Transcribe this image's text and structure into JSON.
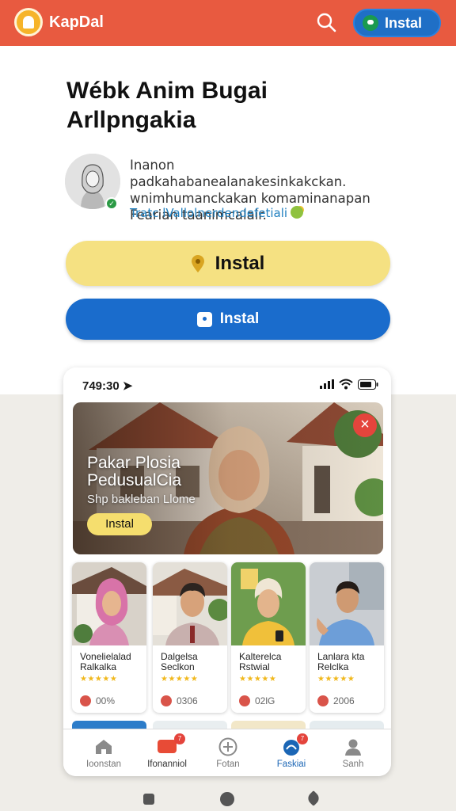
{
  "app": {
    "name": "KapDal",
    "install_label": "Instal"
  },
  "hero": {
    "headline": "Wébk Anim Bugai Arllpngakia",
    "description": "Inanon padkahabanealanakesinkakckan. wnimhumanckakan komaminanapan Fearian taanimcalair.",
    "link_text": "Tratc lVallolnerdendefetiali",
    "primary_button": "Instal",
    "secondary_button": "Instal"
  },
  "phone": {
    "status_time": "749:30",
    "banner": {
      "title": "Pakar Plosia PedusualCia",
      "subtitle": "Shp bakleban Llome",
      "button": "Instal"
    },
    "cards": [
      {
        "name": "Vonelielalad Ralkalka",
        "rating": "★★★★★",
        "stat": "00%"
      },
      {
        "name": "Dalgelsa Seclkon",
        "rating": "★★★★★",
        "stat": "0306"
      },
      {
        "name": "Kalterelca Rstwial",
        "rating": "★★★★★",
        "stat": "02lG"
      },
      {
        "name": "Lanlara kta Relclka",
        "rating": "★★★★★",
        "stat": "2006"
      }
    ],
    "tabs": [
      {
        "label": "Ioonstan",
        "icon": "home-icon"
      },
      {
        "label": "Ifonanniol",
        "icon": "chat-icon",
        "badge": "7"
      },
      {
        "label": "Fotan",
        "icon": "plus-circle-icon"
      },
      {
        "label": "Faskiai",
        "icon": "notification-icon",
        "badge": "7"
      },
      {
        "label": "Sanh",
        "icon": "profile-icon"
      }
    ]
  },
  "colors": {
    "appbar": "#e85a40",
    "primary_blue": "#1a6ccc",
    "yellow": "#f5e182",
    "badge_red": "#e4443c"
  }
}
